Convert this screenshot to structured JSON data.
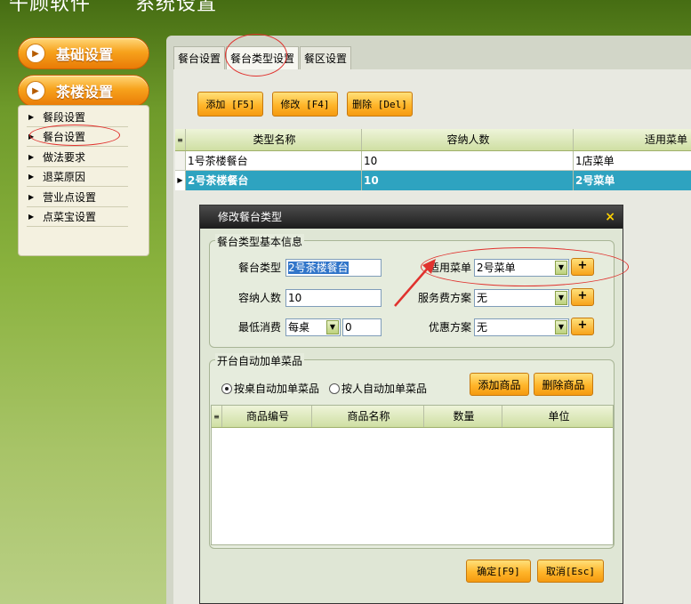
{
  "app": {
    "title_left": "午顾软件",
    "title_right": "系统设置"
  },
  "sidebar": {
    "section1": "基础设置",
    "section2": "茶楼设置",
    "items": [
      {
        "label": "餐段设置"
      },
      {
        "label": "餐台设置"
      },
      {
        "label": "做法要求"
      },
      {
        "label": "退菜原因"
      },
      {
        "label": "营业点设置"
      },
      {
        "label": "点菜宝设置"
      }
    ]
  },
  "tabs": [
    "餐台设置",
    "餐台类型设置",
    "餐区设置"
  ],
  "toolbar": {
    "add": "添加 [F5]",
    "edit": "修改 [F4]",
    "delete": "删除 [Del]"
  },
  "table": {
    "columns": [
      "类型名称",
      "容纳人数",
      "适用菜单"
    ],
    "rows": [
      {
        "name": "1号茶楼餐台",
        "capacity": "10",
        "menu": "1店菜单"
      },
      {
        "name": "2号茶楼餐台",
        "capacity": "10",
        "menu": "2号菜单"
      }
    ]
  },
  "dialog": {
    "title": "修改餐台类型",
    "close": "×",
    "basic_group": "餐台类型基本信息",
    "type_label": "餐台类型",
    "type_value": "2号茶楼餐台",
    "capacity_label": "容纳人数",
    "capacity_value": "10",
    "min_label": "最低消费",
    "min_mode": "每桌",
    "min_value": "0",
    "menu_label": "适用菜单",
    "menu_value": "2号菜单",
    "service_label": "服务费方案",
    "service_value": "无",
    "discount_label": "优惠方案",
    "discount_value": "无",
    "plus": "+",
    "auto_group": "开台自动加单菜品",
    "radio_table": "按桌自动加单菜品",
    "radio_person": "按人自动加单菜品",
    "add_item": "添加商品",
    "delete_item": "删除商品",
    "sub_columns": [
      "商品编号",
      "商品名称",
      "数量",
      "单位"
    ],
    "ok": "确定[F9]",
    "cancel": "取消[Esc]"
  }
}
